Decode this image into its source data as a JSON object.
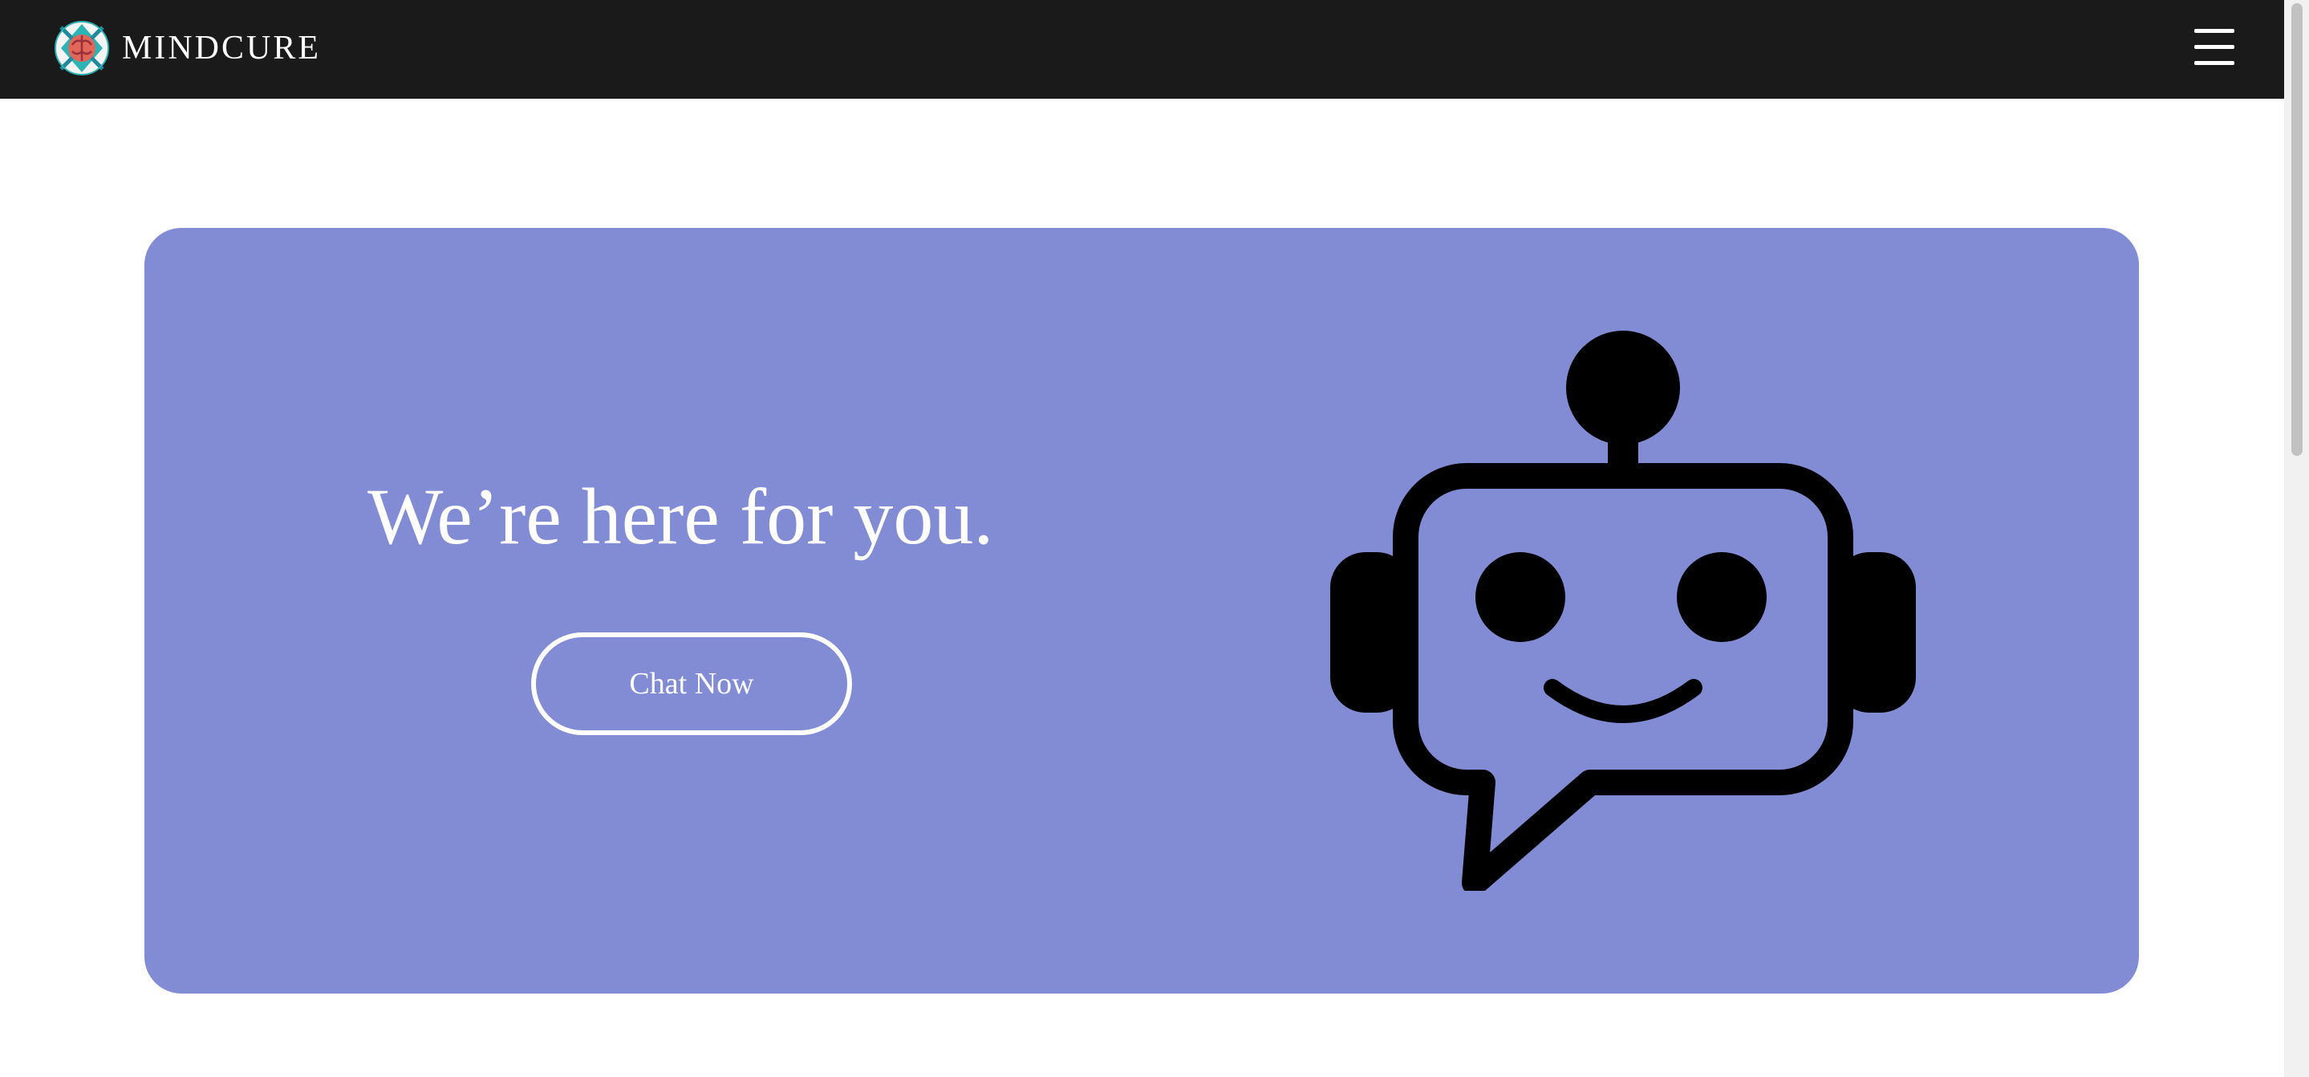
{
  "brand": {
    "name": "MINDCURE",
    "logo_icon": "brain-logo-icon"
  },
  "navbar": {
    "background": "#1a1a1a",
    "menu_icon": "hamburger-menu-icon"
  },
  "hero": {
    "background": "#828cd5",
    "title": "We’re here for you.",
    "cta_label": "Chat Now",
    "illustration_icon": "chat-robot-icon"
  }
}
